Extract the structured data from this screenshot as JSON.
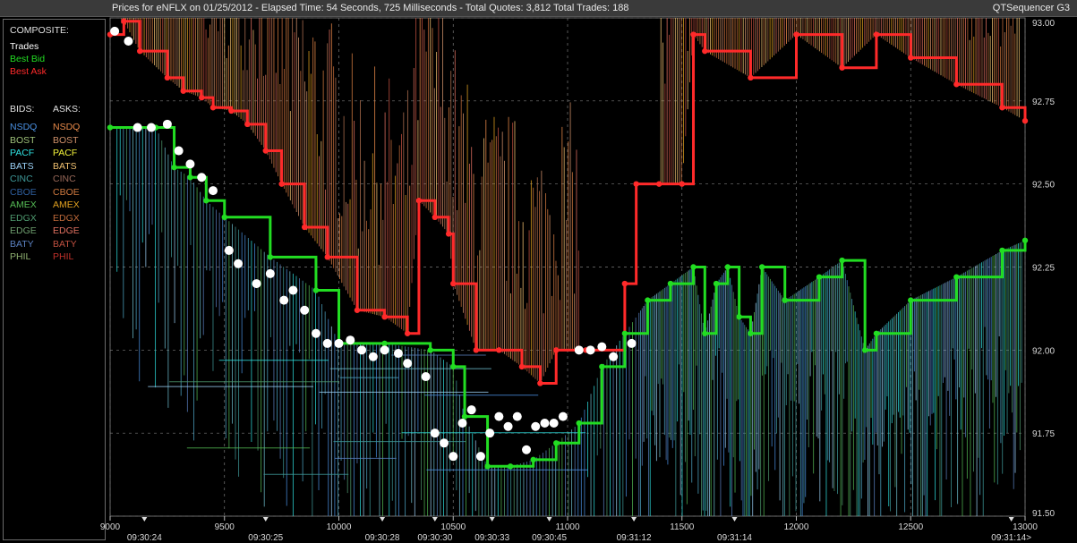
{
  "window": {
    "title": "Prices for  eNFLX  on  01/25/2012  -  Elapsed Time: 54 Seconds, 725 Milliseconds  -  Total Quotes: 3,812  Total Trades: 188",
    "app_name": "QTSequencer G3"
  },
  "legend": {
    "composite_header": "COMPOSITE:",
    "composite_items": [
      {
        "label": "Trades",
        "color": "#ffffff"
      },
      {
        "label": "Best Bid",
        "color": "#22dd22"
      },
      {
        "label": "Best Ask",
        "color": "#ff2a2a"
      }
    ],
    "bids_header": "BIDS:",
    "asks_header": "ASKS:",
    "bids": [
      {
        "label": "NSDQ",
        "color": "#4a90e2"
      },
      {
        "label": "BOST",
        "color": "#9fc27a"
      },
      {
        "label": "PACF",
        "color": "#2fe0e0"
      },
      {
        "label": "BATS",
        "color": "#9ad0f5"
      },
      {
        "label": "CINC",
        "color": "#3f9a9a"
      },
      {
        "label": "CBOE",
        "color": "#2f5f9f"
      },
      {
        "label": "AMEX",
        "color": "#55bb55"
      },
      {
        "label": "EDGX",
        "color": "#4f9a6f"
      },
      {
        "label": "EDGE",
        "color": "#6f9f6f"
      },
      {
        "label": "BATY",
        "color": "#5a80c0"
      },
      {
        "label": "PHIL",
        "color": "#8fb070"
      }
    ],
    "asks": [
      {
        "label": "NSDQ",
        "color": "#e98a4a"
      },
      {
        "label": "BOST",
        "color": "#d0906a"
      },
      {
        "label": "PACF",
        "color": "#f2f23a"
      },
      {
        "label": "BATS",
        "color": "#f0c070"
      },
      {
        "label": "CINC",
        "color": "#9a6a5a"
      },
      {
        "label": "CBOE",
        "color": "#d07a40"
      },
      {
        "label": "AMEX",
        "color": "#e0a020"
      },
      {
        "label": "EDGX",
        "color": "#c06a3a"
      },
      {
        "label": "EDGE",
        "color": "#e07060"
      },
      {
        "label": "BATY",
        "color": "#c05040"
      },
      {
        "label": "PHIL",
        "color": "#c0302a"
      }
    ]
  },
  "chart_data": {
    "type": "line",
    "title": "",
    "xlabel": "",
    "ylabel": "",
    "x_range": [
      9000,
      13000
    ],
    "ylim": [
      91.5,
      93.0
    ],
    "grid": true,
    "y_ticks": [
      "93.00",
      "92.75",
      "92.50",
      "92.25",
      "92.00",
      "91.75",
      "91.50"
    ],
    "y_tick_values": [
      93.0,
      92.75,
      92.5,
      92.25,
      92.0,
      91.75,
      91.5
    ],
    "x_ticks": [
      {
        "value": 9000,
        "label": "9000"
      },
      {
        "value": 9500,
        "label": "9500"
      },
      {
        "value": 10000,
        "label": "10000"
      },
      {
        "value": 10500,
        "label": "10500"
      },
      {
        "value": 11000,
        "label": "11000"
      },
      {
        "value": 11500,
        "label": "11500"
      },
      {
        "value": 12000,
        "label": "12000"
      },
      {
        "value": 12500,
        "label": "12500"
      },
      {
        "value": 13000,
        "label": "13000"
      }
    ],
    "time_labels": [
      {
        "value": 9150,
        "label": "09:30:24"
      },
      {
        "value": 9680,
        "label": "09:30:25"
      },
      {
        "value": 10190,
        "label": "09:30:28"
      },
      {
        "value": 10420,
        "label": "09:30:30"
      },
      {
        "value": 10670,
        "label": "09:30:33"
      },
      {
        "value": 10920,
        "label": "09:30:45"
      },
      {
        "value": 11290,
        "label": "09:31:12"
      },
      {
        "value": 11730,
        "label": "09:31:14"
      },
      {
        "value": 12940,
        "label": "09:31:14>"
      }
    ],
    "series": [
      {
        "name": "Best Ask",
        "color": "#ff2a2a",
        "x": [
          9000,
          9060,
          9130,
          9250,
          9320,
          9400,
          9450,
          9530,
          9600,
          9680,
          9750,
          9850,
          9950,
          10080,
          10200,
          10300,
          10350,
          10420,
          10480,
          10500,
          10600,
          10700,
          10800,
          10880,
          10950,
          11080,
          11250,
          11300,
          11400,
          11500,
          11550,
          11600,
          11800,
          12000,
          12200,
          12350,
          12500,
          12700,
          12900,
          13000
        ],
        "y": [
          92.95,
          92.99,
          92.9,
          92.82,
          92.78,
          92.76,
          92.73,
          92.72,
          92.68,
          92.6,
          92.5,
          92.37,
          92.28,
          92.12,
          92.1,
          92.05,
          92.45,
          92.4,
          92.35,
          92.2,
          92.0,
          92.0,
          91.95,
          91.9,
          92.0,
          92.0,
          92.2,
          92.5,
          92.5,
          92.5,
          92.95,
          92.9,
          92.82,
          92.95,
          92.85,
          92.95,
          92.88,
          92.8,
          92.73,
          92.69
        ]
      },
      {
        "name": "Best Bid",
        "color": "#22dd22",
        "x": [
          9000,
          9200,
          9280,
          9350,
          9420,
          9500,
          9700,
          9900,
          10000,
          10200,
          10400,
          10500,
          10550,
          10650,
          10750,
          10850,
          10950,
          11050,
          11150,
          11250,
          11350,
          11450,
          11550,
          11600,
          11650,
          11700,
          11750,
          11800,
          11850,
          11950,
          12100,
          12200,
          12300,
          12350,
          12500,
          12700,
          12900,
          13000
        ],
        "y": [
          92.67,
          92.67,
          92.55,
          92.52,
          92.45,
          92.4,
          92.28,
          92.18,
          92.02,
          92.02,
          92.0,
          91.95,
          91.8,
          91.65,
          91.65,
          91.67,
          91.72,
          91.78,
          91.95,
          92.05,
          92.15,
          92.2,
          92.25,
          92.05,
          92.2,
          92.25,
          92.1,
          92.05,
          92.25,
          92.15,
          92.22,
          92.27,
          92.0,
          92.05,
          92.15,
          92.22,
          92.3,
          92.33
        ]
      },
      {
        "name": "Trades",
        "color": "#ffffff",
        "x": [
          9020,
          9080,
          9120,
          9180,
          9250,
          9300,
          9350,
          9400,
          9450,
          9520,
          9560,
          9640,
          9700,
          9760,
          9800,
          9850,
          9900,
          9950,
          10000,
          10050,
          10100,
          10150,
          10200,
          10260,
          10300,
          10380,
          10420,
          10460,
          10500,
          10540,
          10580,
          10620,
          10660,
          10700,
          10740,
          10780,
          10820,
          10860,
          10900,
          10940,
          10980,
          11050,
          11100,
          11150,
          11200,
          11280
        ],
        "y": [
          92.96,
          92.93,
          92.67,
          92.67,
          92.68,
          92.6,
          92.56,
          92.52,
          92.48,
          92.3,
          92.26,
          92.2,
          92.23,
          92.15,
          92.18,
          92.12,
          92.05,
          92.02,
          92.02,
          92.03,
          92.0,
          91.98,
          92.0,
          91.99,
          91.96,
          91.92,
          91.75,
          91.72,
          91.68,
          91.78,
          91.82,
          91.68,
          91.75,
          91.8,
          91.77,
          91.8,
          91.7,
          91.77,
          91.78,
          91.78,
          91.8,
          92.0,
          92.0,
          92.01,
          91.98,
          92.02
        ]
      }
    ]
  }
}
